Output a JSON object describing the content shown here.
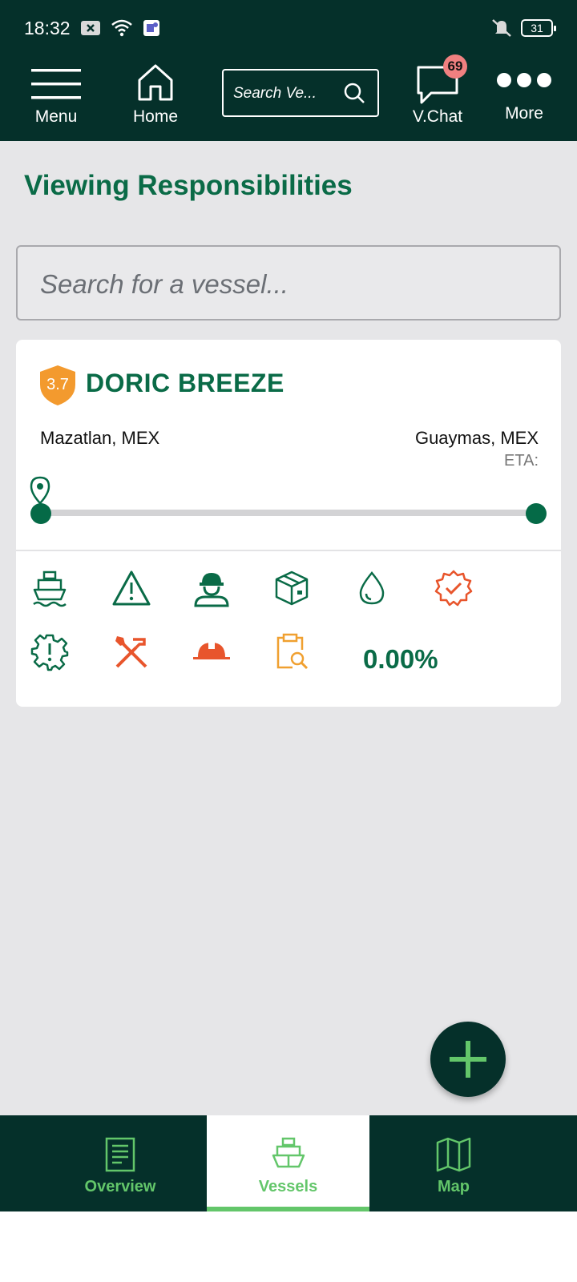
{
  "status_bar": {
    "time": "18:32",
    "battery": "31"
  },
  "top_nav": {
    "menu_label": "Menu",
    "home_label": "Home",
    "search_placeholder": "Search Ve...",
    "chat_label": "V.Chat",
    "chat_badge": "69",
    "more_label": "More"
  },
  "page": {
    "title": "Viewing Responsibilities",
    "vessel_search_placeholder": "Search for a vessel..."
  },
  "vessel_card": {
    "rating": "3.7",
    "name": "DORIC BREEZE",
    "origin": "Mazatlan, MEX",
    "destination": "Guaymas, MEX",
    "eta_label": "ETA:",
    "progress": 0,
    "percentage": "0.00%",
    "icons": [
      "ship-icon",
      "warning-icon",
      "crew-icon",
      "package-icon",
      "drop-icon",
      "certificate-icon",
      "gear-alert-icon",
      "tools-icon",
      "hardhat-icon",
      "clipboard-search-icon"
    ],
    "colors": {
      "green": "#0a6b47",
      "orange": "#e8552c",
      "amber": "#f0a030"
    }
  },
  "bottom_nav": {
    "overview_label": "Overview",
    "vessels_label": "Vessels",
    "map_label": "Map",
    "active": "Vessels"
  }
}
